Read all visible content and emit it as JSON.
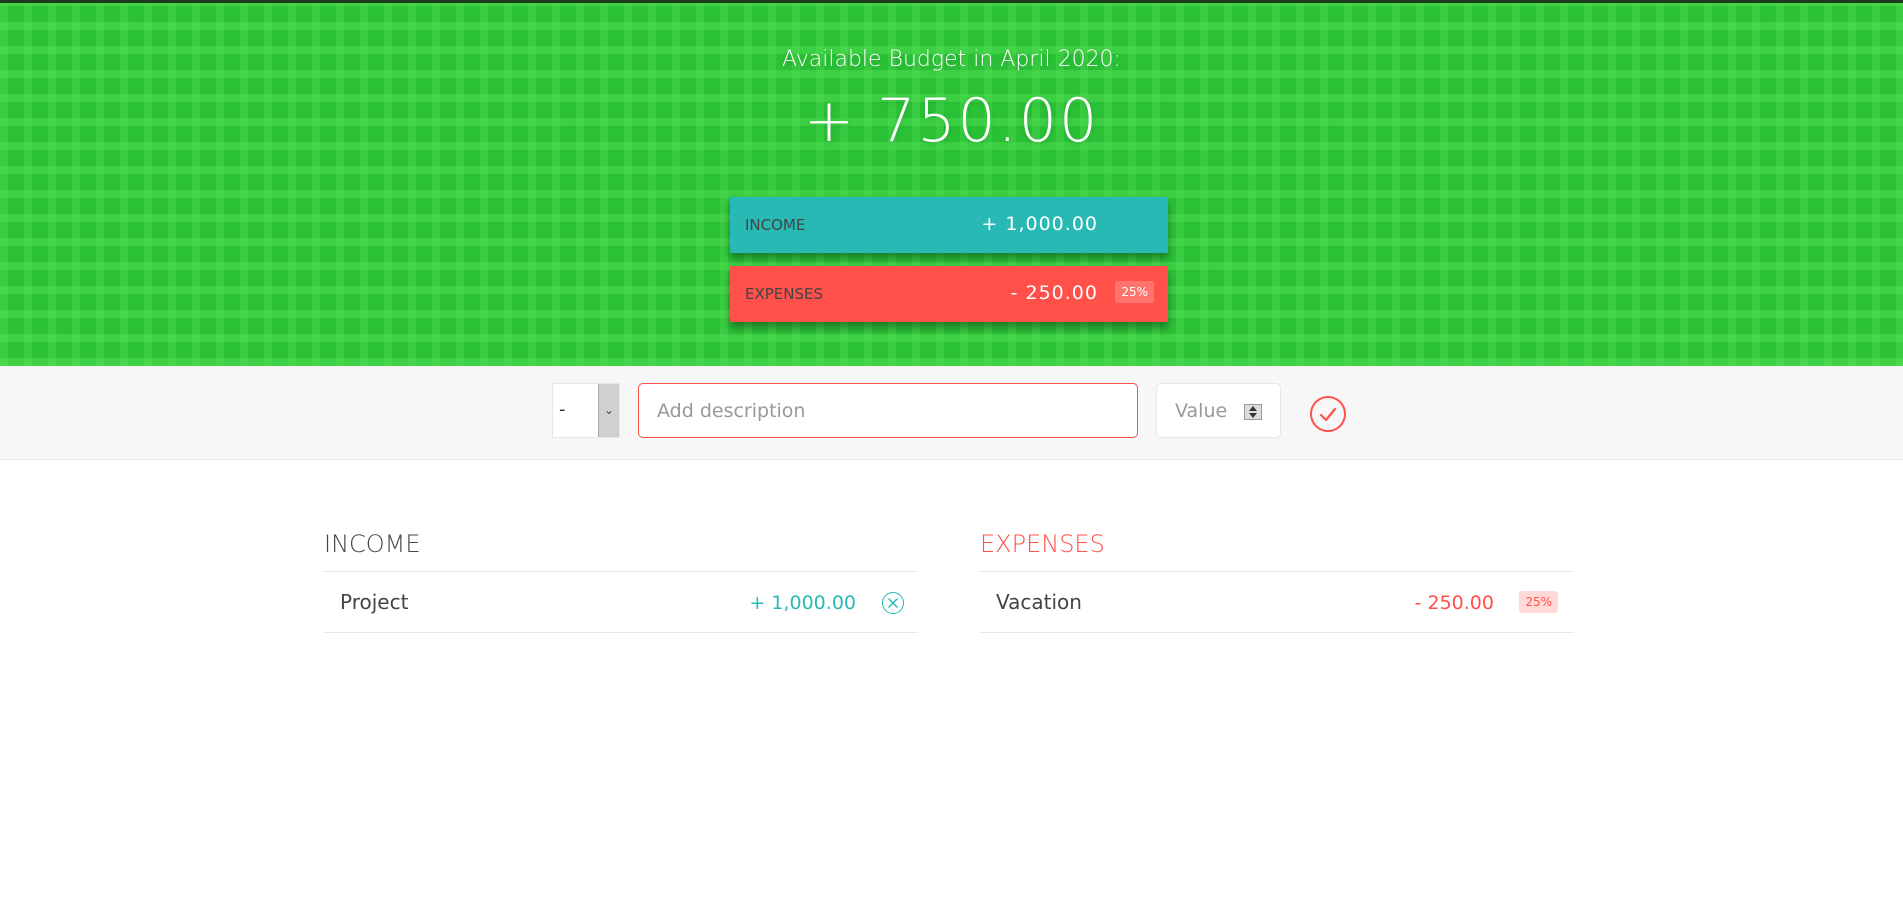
{
  "header": {
    "title": "Available Budget in April 2020:",
    "budget_value": "+ 750.00",
    "income": {
      "label": "INCOME",
      "value": "+ 1,000.00"
    },
    "expenses": {
      "label": "EXPENSES",
      "value": "- 250.00",
      "percentage": "25%"
    }
  },
  "add_form": {
    "type_selected": "-",
    "description_placeholder": "Add description",
    "value_placeholder": "Value",
    "submit_icon": "checkmark-circle-icon"
  },
  "income_list": {
    "title": "INCOME",
    "items": [
      {
        "description": "Project",
        "value": "+ 1,000.00",
        "delete_icon": "close-circle-icon"
      }
    ]
  },
  "expenses_list": {
    "title": "EXPENSES",
    "items": [
      {
        "description": "Vacation",
        "value": "- 250.00",
        "percentage": "25%"
      }
    ]
  },
  "colors": {
    "header_green": "#2bc137",
    "income_teal": "#28b9b5",
    "expense_red": "#ff5049"
  }
}
